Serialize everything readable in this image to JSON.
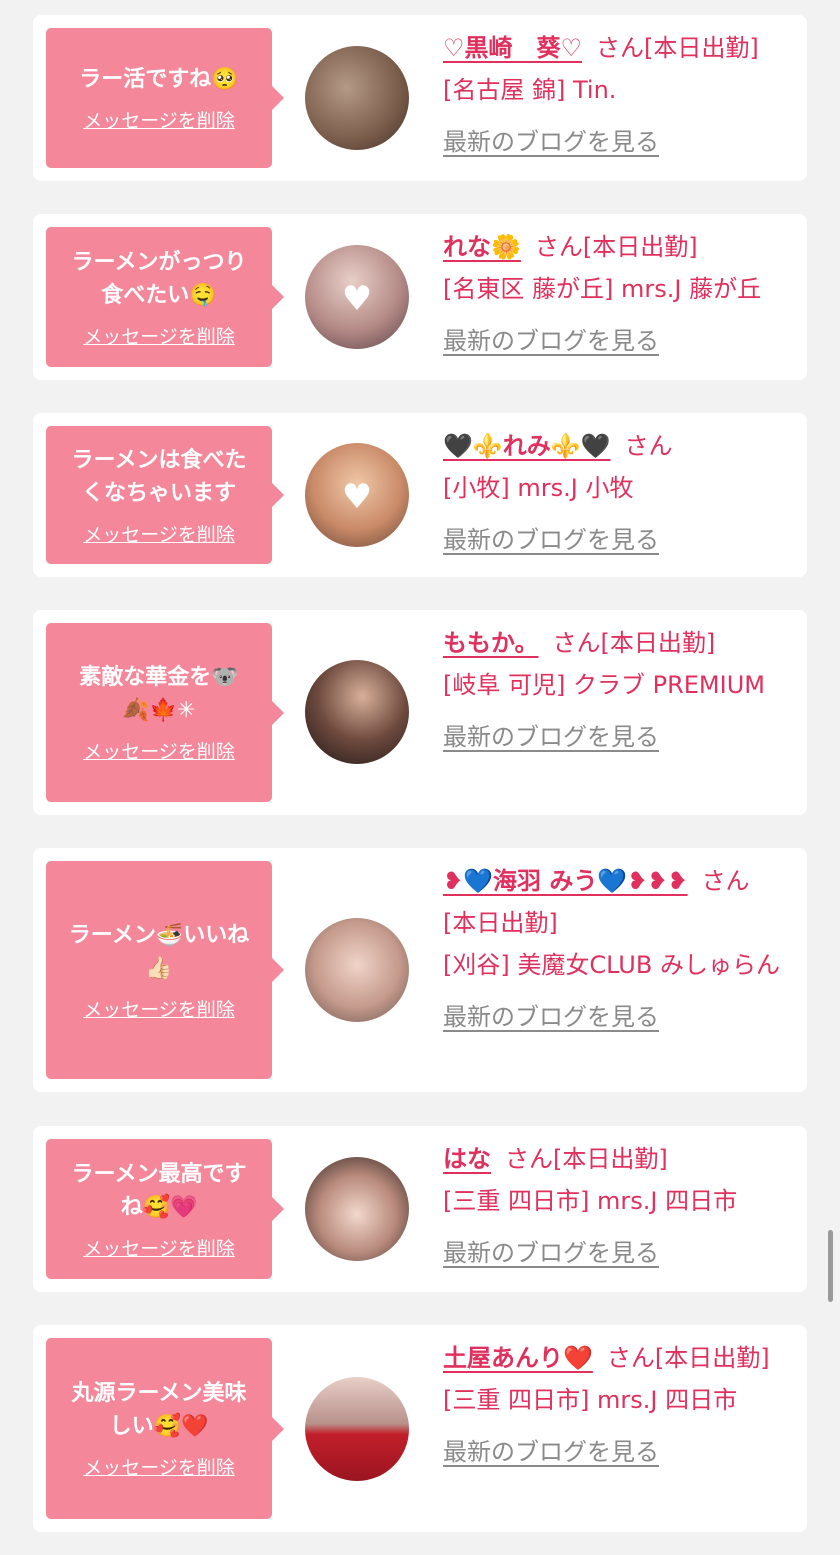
{
  "cards": [
    {
      "message": "ラー活ですね🥺",
      "delete_label": "メッセージを削除",
      "name": "♡黒崎　葵♡",
      "san": "さん",
      "status": "[本日出勤]",
      "shop": "[名古屋 錦] Tin.",
      "blog_label": "最新のブログを見る"
    },
    {
      "message": "ラーメンがっつり\n食べたい🤤",
      "delete_label": "メッセージを削除",
      "name": "れな🌼",
      "san": "さん",
      "status": "[本日出勤]",
      "shop": "[名東区 藤が丘] mrs.J 藤が丘",
      "blog_label": "最新のブログを見る"
    },
    {
      "message": "ラーメンは食べた\nくなちゃいます",
      "delete_label": "メッセージを削除",
      "name": "🖤⚜️れみ⚜️🖤",
      "san": "さん",
      "status": "",
      "shop": "[小牧] mrs.J 小牧",
      "blog_label": "最新のブログを見る"
    },
    {
      "message": "素敵な華金を🐨\n🍂🍁✳",
      "delete_label": "メッセージを削除",
      "name": "ももか。",
      "san": "さん",
      "status": "[本日出勤]",
      "shop": "[岐阜 可児] クラブ PREMIUM",
      "blog_label": "最新のブログを見る"
    },
    {
      "message": "ラーメン🍜いいね\n👍🏻",
      "delete_label": "メッセージを削除",
      "name": "❥💙海羽 みう💙❥❥❥",
      "san": "さん",
      "status": "[本日出勤]",
      "shop": "[刈谷] 美魔女CLUB みしゅらん",
      "blog_label": "最新のブログを見る"
    },
    {
      "message": "ラーメン最高です\nね🥰💗",
      "delete_label": "メッセージを削除",
      "name": "はな",
      "san": "さん",
      "status": "[本日出勤]",
      "shop": "[三重 四日市] mrs.J 四日市",
      "blog_label": "最新のブログを見る"
    },
    {
      "message": "丸源ラーメン美味\nしい🥰❤️",
      "delete_label": "メッセージを削除",
      "name": "土屋あんり❤️",
      "san": "さん",
      "status": "[本日出勤]",
      "shop": "[三重 四日市] mrs.J 四日市",
      "blog_label": "最新のブログを見る"
    }
  ],
  "colors": {
    "accent": "#e0305e",
    "bubble": "#f5879a",
    "muted": "#8a8a8a",
    "background": "#f2f2f2"
  }
}
